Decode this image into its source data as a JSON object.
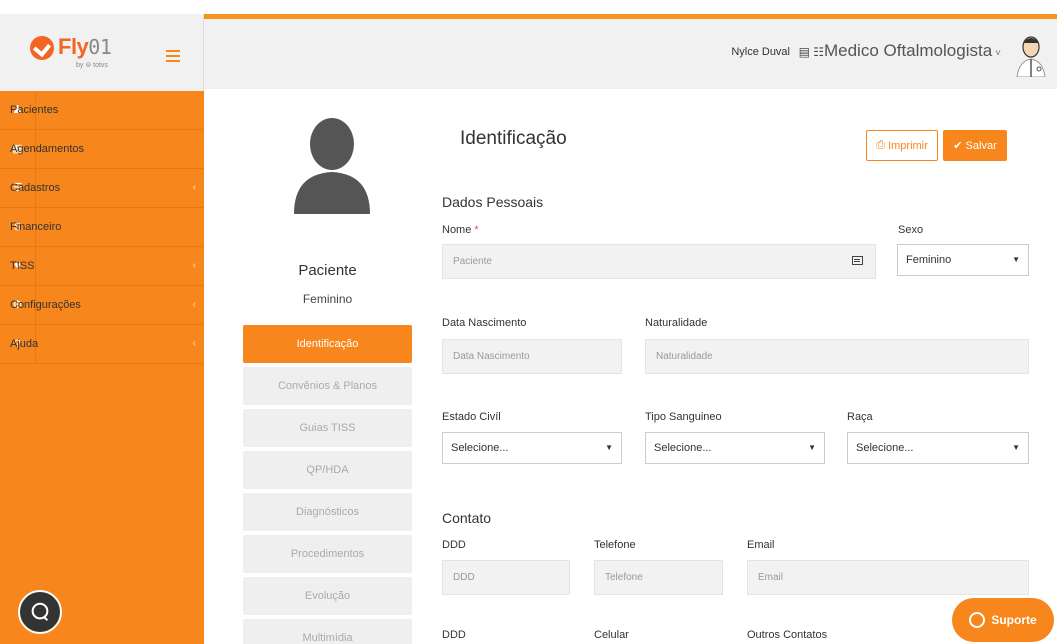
{
  "app": {
    "logo_text": "Fly",
    "logo_num": "01",
    "logo_sub": "by ⊜ totvs"
  },
  "sidebar": {
    "items": [
      {
        "label": "Pacientes",
        "icon": "users-icon",
        "glyph": "♟"
      },
      {
        "label": "Agendamentos",
        "icon": "calendar-icon",
        "glyph": "▦"
      },
      {
        "label": "Cadastros",
        "icon": "list-icon",
        "glyph": "☰",
        "chevron": "‹"
      },
      {
        "label": "Financeiro",
        "icon": "dollar-icon",
        "glyph": "$"
      },
      {
        "label": "TISS",
        "icon": "heartbeat-icon",
        "glyph": "♥",
        "chevron": "‹"
      },
      {
        "label": "Configurações",
        "icon": "gear-icon",
        "glyph": "⚙",
        "chevron": "‹"
      },
      {
        "label": "Ajuda",
        "icon": "question-icon",
        "glyph": "?",
        "chevron": "‹"
      }
    ]
  },
  "header": {
    "user_name": "Nylce Duval",
    "role": "Medico Oftalmologista",
    "caret": "˅"
  },
  "patient": {
    "name": "Paciente",
    "sex": "Feminino"
  },
  "tabs": [
    {
      "label": "Identificação",
      "active": true
    },
    {
      "label": "Convênios & Planos",
      "active": false
    },
    {
      "label": "Guias TISS",
      "active": false
    },
    {
      "label": "QP/HDA",
      "active": false
    },
    {
      "label": "Diagnósticos",
      "active": false
    },
    {
      "label": "Procedimentos",
      "active": false
    },
    {
      "label": "Evolução",
      "active": false
    },
    {
      "label": "Multimídia",
      "active": false
    }
  ],
  "form": {
    "title": "Identificação",
    "print_label": "Imprimir",
    "save_label": "Salvar",
    "personal_heading": "Dados Pessoais",
    "nome_label": "Nome",
    "nome_required": "*",
    "nome_placeholder": "Paciente",
    "sexo_label": "Sexo",
    "sexo_value": "Feminino",
    "nascimento_label": "Data Nascimento",
    "nascimento_placeholder": "Data Nascimento",
    "naturalidade_label": "Naturalidade",
    "naturalidade_placeholder": "Naturalidade",
    "estado_civil_label": "Estado Civíl",
    "estado_civil_value": "Selecione...",
    "tipo_sanguineo_label": "Tipo Sanguineo",
    "tipo_sanguineo_value": "Selecione...",
    "raca_label": "Raça",
    "raca_value": "Selecione...",
    "contact_heading": "Contato",
    "ddd_label": "DDD",
    "ddd_placeholder": "DDD",
    "telefone_label": "Telefone",
    "telefone_placeholder": "Telefone",
    "email_label": "Email",
    "email_placeholder": "Email",
    "ddd2_label": "DDD",
    "celular_label": "Celular",
    "outros_label": "Outros Contatos"
  },
  "support_label": "Suporte",
  "colors": {
    "accent": "#f7861c",
    "sidebar_bg": "#f7861c",
    "header_bg": "#f1f1f1"
  }
}
